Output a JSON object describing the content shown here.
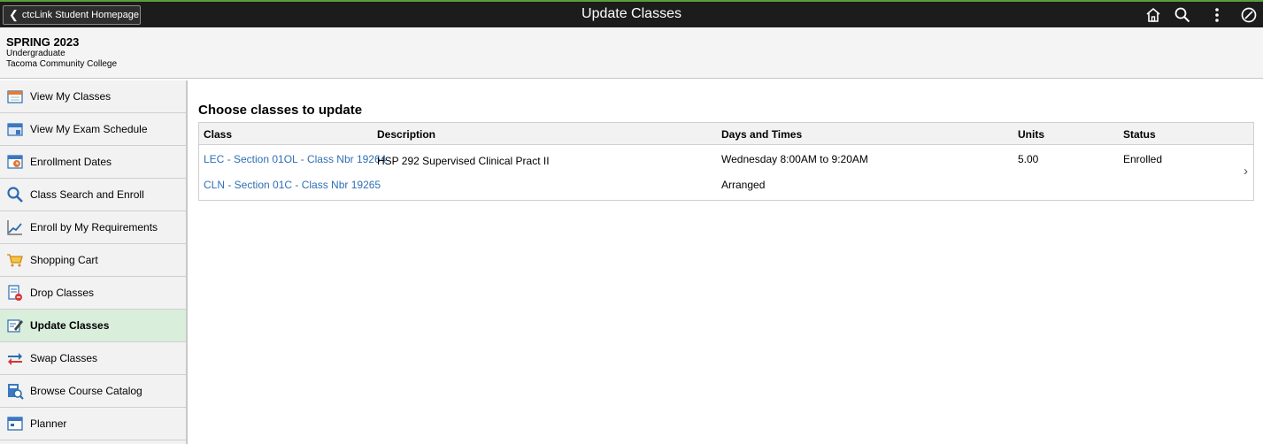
{
  "header": {
    "back_label": "ctcLink Student Homepage",
    "title": "Update Classes"
  },
  "term": {
    "name": "SPRING 2023",
    "career": "Undergraduate",
    "institution": "Tacoma Community College"
  },
  "sidebar": {
    "items": [
      {
        "label": "View My Classes",
        "icon": "calendar-icon"
      },
      {
        "label": "View My Exam Schedule",
        "icon": "exam-calendar-icon"
      },
      {
        "label": "Enrollment Dates",
        "icon": "clock-calendar-icon"
      },
      {
        "label": "Class Search and Enroll",
        "icon": "search-icon"
      },
      {
        "label": "Enroll by My Requirements",
        "icon": "chart-line-icon"
      },
      {
        "label": "Shopping Cart",
        "icon": "cart-icon"
      },
      {
        "label": "Drop Classes",
        "icon": "drop-icon"
      },
      {
        "label": "Update Classes",
        "icon": "edit-icon",
        "active": true
      },
      {
        "label": "Swap Classes",
        "icon": "swap-icon"
      },
      {
        "label": "Browse Course Catalog",
        "icon": "catalog-icon"
      },
      {
        "label": "Planner",
        "icon": "planner-icon"
      }
    ]
  },
  "main": {
    "section_title": "Choose classes to update",
    "columns": [
      "Class",
      "Description",
      "Days and Times",
      "Units",
      "Status"
    ],
    "row": {
      "class_lines": [
        "LEC - Section 01OL - Class Nbr 19264",
        "CLN - Section 01C - Class Nbr 19265"
      ],
      "description": "HSP 292 Supervised Clinical Pract II",
      "times": [
        "Wednesday 8:00AM to 9:20AM",
        "Arranged"
      ],
      "units": "5.00",
      "status": "Enrolled"
    }
  },
  "colors": {
    "header_bg": "#1c1c1c",
    "accent_green": "#5a9e3b",
    "active_bg": "#d9eedb",
    "link": "#2f6fb5"
  }
}
